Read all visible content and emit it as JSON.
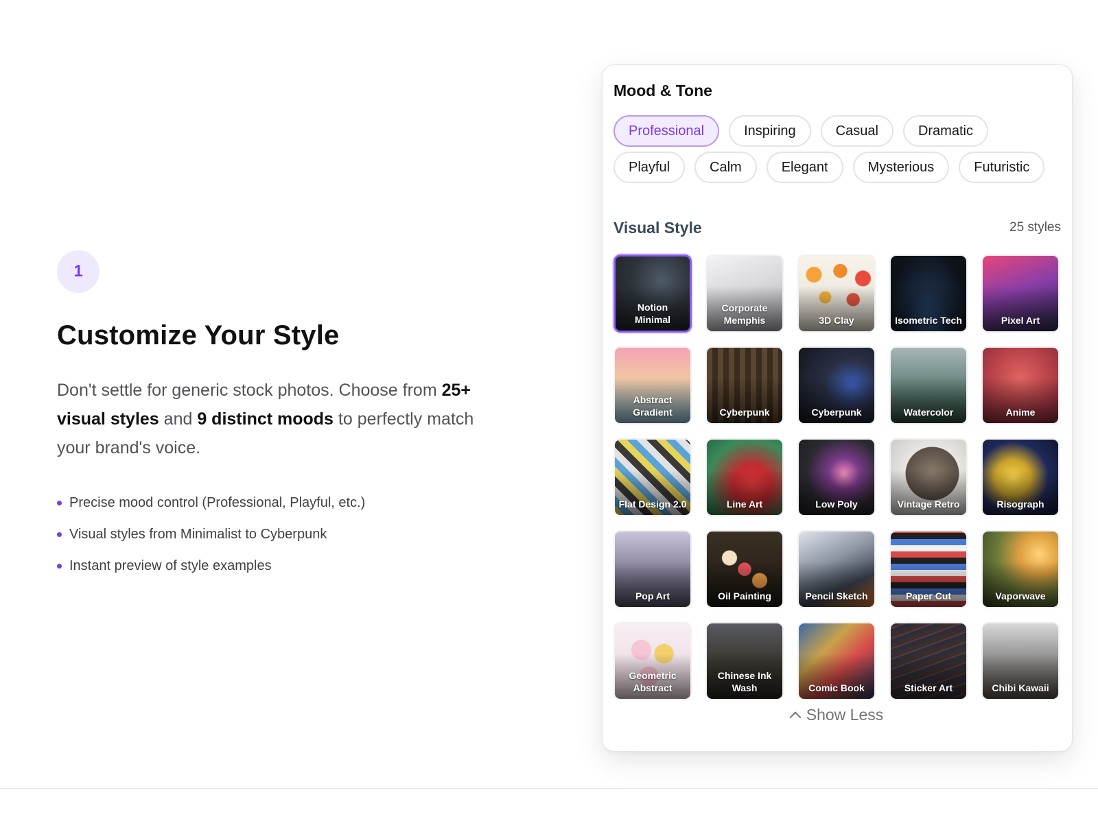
{
  "step": {
    "number": "1"
  },
  "heading": "Customize Your Style",
  "description": {
    "part1": "Don't settle for generic stock photos. Choose from ",
    "bold1": "25+ visual styles",
    "part2": " and ",
    "bold2": "9 distinct moods",
    "part3": " to perfectly match your brand's voice."
  },
  "features": [
    "Precise mood control (Professional, Playful, etc.)",
    "Visual styles from Minimalist to Cyberpunk",
    "Instant preview of style examples"
  ],
  "mood": {
    "title": "Mood & Tone",
    "options": [
      "Professional",
      "Inspiring",
      "Casual",
      "Dramatic",
      "Playful",
      "Calm",
      "Elegant",
      "Mysterious",
      "Futuristic"
    ],
    "selected": "Professional"
  },
  "visual_style": {
    "title": "Visual Style",
    "count_label": "25 styles",
    "selected": "Notion Minimal",
    "styles": [
      "Notion Minimal",
      "Corporate Memphis",
      "3D Clay",
      "Isometric Tech",
      "Pixel Art",
      "Abstract Gradient",
      "Cyberpunk",
      "Cyberpunk",
      "Watercolor",
      "Anime",
      "Flat Design 2.0",
      "Line Art",
      "Low Poly",
      "Vintage Retro",
      "Risograph",
      "Pop Art",
      "Oil Painting",
      "Pencil Sketch",
      "Paper Cut",
      "Vaporwave",
      "Geometric Abstract",
      "Chinese Ink Wash",
      "Comic Book",
      "Sticker Art",
      "Chibi Kawaii"
    ]
  },
  "show_less_label": "Show Less",
  "colors": {
    "accent": "#7c3aed",
    "accent_light": "#f3ecff",
    "badge_bg": "#efe9fd"
  }
}
